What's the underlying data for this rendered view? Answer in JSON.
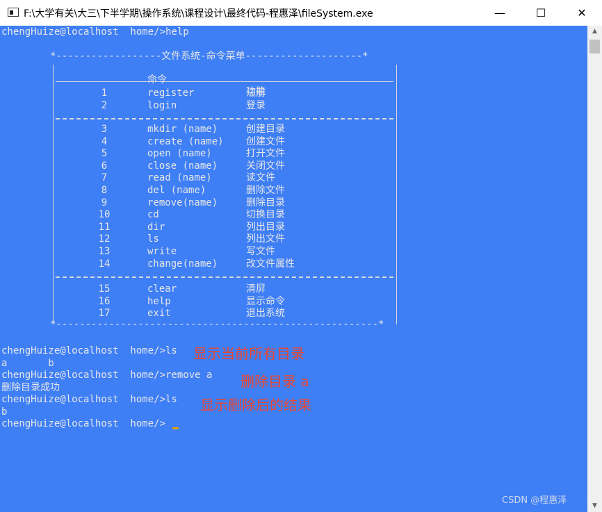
{
  "window": {
    "title": "F:\\大学有关\\大三\\下半学期\\操作系统\\课程设计\\最终代码-程惠泽\\fileSystem.exe",
    "minimize_glyph": "—",
    "maximize_glyph": "☐",
    "close_glyph": "✕"
  },
  "console": {
    "prompt1": "chengHuize@localhost  home/>help",
    "menu": {
      "top_border": "*------------------文件系统-命令菜单--------------------*",
      "bottom_border": "*-------------------------------------------------------*",
      "header_cmd": "命令",
      "header_fn": "功能",
      "group1": [
        {
          "num": "1",
          "cmd": "register",
          "fn": "注册"
        },
        {
          "num": "2",
          "cmd": "login",
          "fn": "登录"
        }
      ],
      "group2": [
        {
          "num": "3",
          "cmd": "mkdir (name)",
          "fn": "创建目录"
        },
        {
          "num": "4",
          "cmd": "create (name)",
          "fn": "创建文件"
        },
        {
          "num": "5",
          "cmd": "open (name)",
          "fn": "打开文件"
        },
        {
          "num": "6",
          "cmd": "close (name)",
          "fn": "关闭文件"
        },
        {
          "num": "7",
          "cmd": "read (name)",
          "fn": "读文件"
        },
        {
          "num": "8",
          "cmd": "del (name)",
          "fn": "删除文件"
        },
        {
          "num": "9",
          "cmd": "remove(name)",
          "fn": "删除目录"
        },
        {
          "num": "10",
          "cmd": "cd",
          "fn": "切换目录"
        },
        {
          "num": "11",
          "cmd": "dir",
          "fn": "列出目录"
        },
        {
          "num": "12",
          "cmd": "ls",
          "fn": "列出文件"
        },
        {
          "num": "13",
          "cmd": "write",
          "fn": "写文件"
        },
        {
          "num": "14",
          "cmd": "change(name)",
          "fn": "改文件属性"
        }
      ],
      "group3": [
        {
          "num": "15",
          "cmd": "clear",
          "fn": "清屏"
        },
        {
          "num": "16",
          "cmd": "help",
          "fn": "显示命令"
        },
        {
          "num": "17",
          "cmd": "exit",
          "fn": "退出系统"
        }
      ]
    },
    "prompt2": "chengHuize@localhost  home/>ls",
    "output2": "a       b",
    "prompt3": "chengHuize@localhost  home/>remove a",
    "output3": "删除目录成功",
    "prompt4": "chengHuize@localhost  home/>ls",
    "output4": "b",
    "prompt5": "chengHuize@localhost  home/>"
  },
  "annotations": {
    "a1": "显示当前所有目录",
    "a2": "删除目录 a",
    "a3": "显示删除后的结果"
  },
  "watermark": "CSDN @程惠泽",
  "colors": {
    "console_bg": "#3e7ff6",
    "console_text": "#e6e6e6",
    "annotation": "#e8452f",
    "cursor": "#e0a000"
  }
}
